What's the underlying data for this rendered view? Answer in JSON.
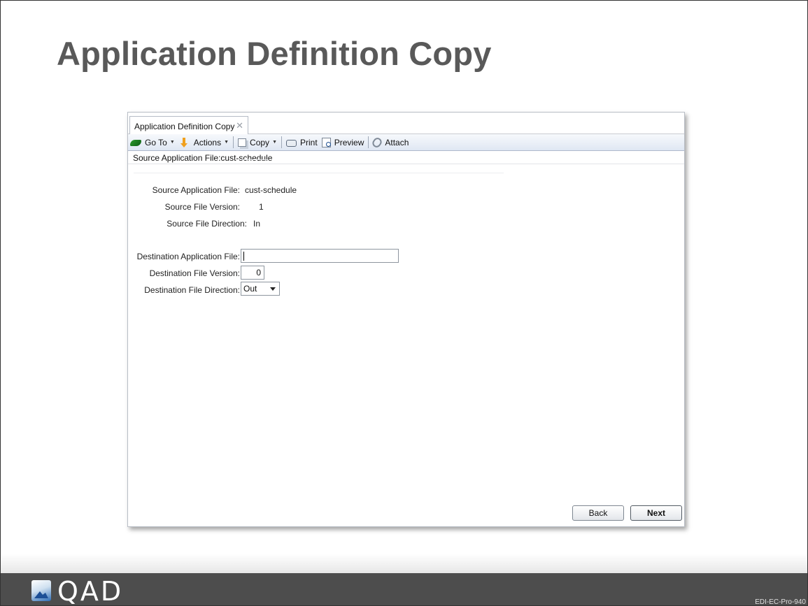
{
  "slide": {
    "title": "Application Definition Copy",
    "code": "EDI-EC-Pro-940",
    "logo_text": "QAD"
  },
  "window": {
    "tab_label": "Application Definition Copy",
    "tab_close": "✕"
  },
  "toolbar": {
    "goto_label": "Go To",
    "actions_label": "Actions",
    "copy_label": "Copy",
    "print_label": "Print",
    "preview_label": "Preview",
    "attach_label": "Attach",
    "caret": "▼"
  },
  "section": {
    "title": "Source Application File:cust-schedule"
  },
  "form": {
    "source_file_label": "Source Application File:",
    "source_file_value": "cust-schedule",
    "source_version_label": "Source File Version:",
    "source_version_value": "1",
    "source_direction_label": "Source File Direction:",
    "source_direction_value": "In",
    "dest_file_label": "Destination Application File:",
    "dest_file_value": "",
    "dest_version_label": "Destination File Version:",
    "dest_version_value": "0",
    "dest_direction_label": "Destination File Direction:",
    "dest_direction_value": "Out"
  },
  "buttons": {
    "back_label": "Back",
    "next_label": "Next"
  },
  "colors": {
    "title": "#595959",
    "footer": "#4d4d4d",
    "toolbar_bg": "#dfe7f3"
  }
}
